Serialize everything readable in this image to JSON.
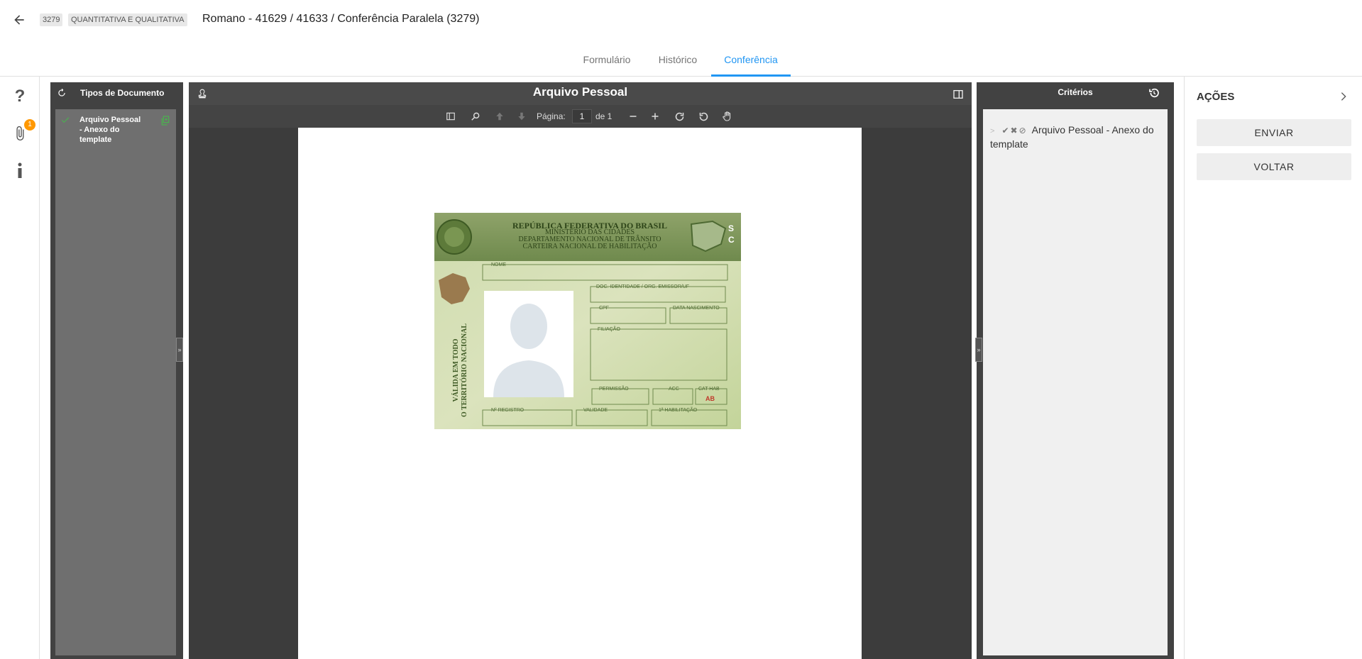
{
  "header": {
    "id_badge": "3279",
    "type_badge": "QUANTITATIVA E QUALITATIVA",
    "title": "Romano - 41629 / 41633 / Conferência Paralela (3279)"
  },
  "tabs": [
    {
      "label": "Formulário"
    },
    {
      "label": "Histórico"
    },
    {
      "label": "Conferência"
    }
  ],
  "left_rail": {
    "attachment_count": "1"
  },
  "types_panel": {
    "title": "Tipos de Documento",
    "items": [
      {
        "label": "Arquivo Pessoal - Anexo do template",
        "status": "check"
      }
    ]
  },
  "viewer": {
    "title": "Arquivo Pessoal",
    "page_label": "Página:",
    "page_value": "1",
    "page_total": "de 1",
    "document": {
      "card_header_1": "REPÚBLICA FEDERATIVA DO BRASIL",
      "card_header_2": "MINISTÉRIO DAS CIDADES",
      "card_header_3": "DEPARTAMENTO NACIONAL DE TRÂNSITO",
      "card_header_4": "CARTEIRA NACIONAL DE HABILITAÇÃO",
      "state": "SC",
      "field_nome": "NOME",
      "field_doc": "DOC. IDENTIDADE / ORG. EMISSOR/UF",
      "field_cpf": "CPF",
      "field_nasc": "DATA NASCIMENTO",
      "field_filiacao": "FILIAÇÃO",
      "field_permissao": "PERMISSÃO",
      "field_acc": "ACC",
      "field_cat": "CAT HAB",
      "cat_value": "AB",
      "field_registro": "Nº REGISTRO",
      "field_validade": "VALIDADE",
      "field_habilitacao": "1ª HABILITAÇÃO",
      "side_text_1": "VÁLIDA EM TODO",
      "side_text_2": "O TERRITÓRIO NACIONAL"
    }
  },
  "criterios": {
    "title": "Critérios",
    "items": [
      {
        "label": "Arquivo Pessoal - Anexo do template"
      }
    ]
  },
  "acoes": {
    "title": "AÇÕES",
    "buttons": [
      {
        "label": "ENVIAR"
      },
      {
        "label": "VOLTAR"
      }
    ]
  },
  "colors": {
    "accent": "#2196f3",
    "panel_dark": "#424242",
    "check_green": "#4caf50",
    "badge_orange": "#ff9800"
  }
}
